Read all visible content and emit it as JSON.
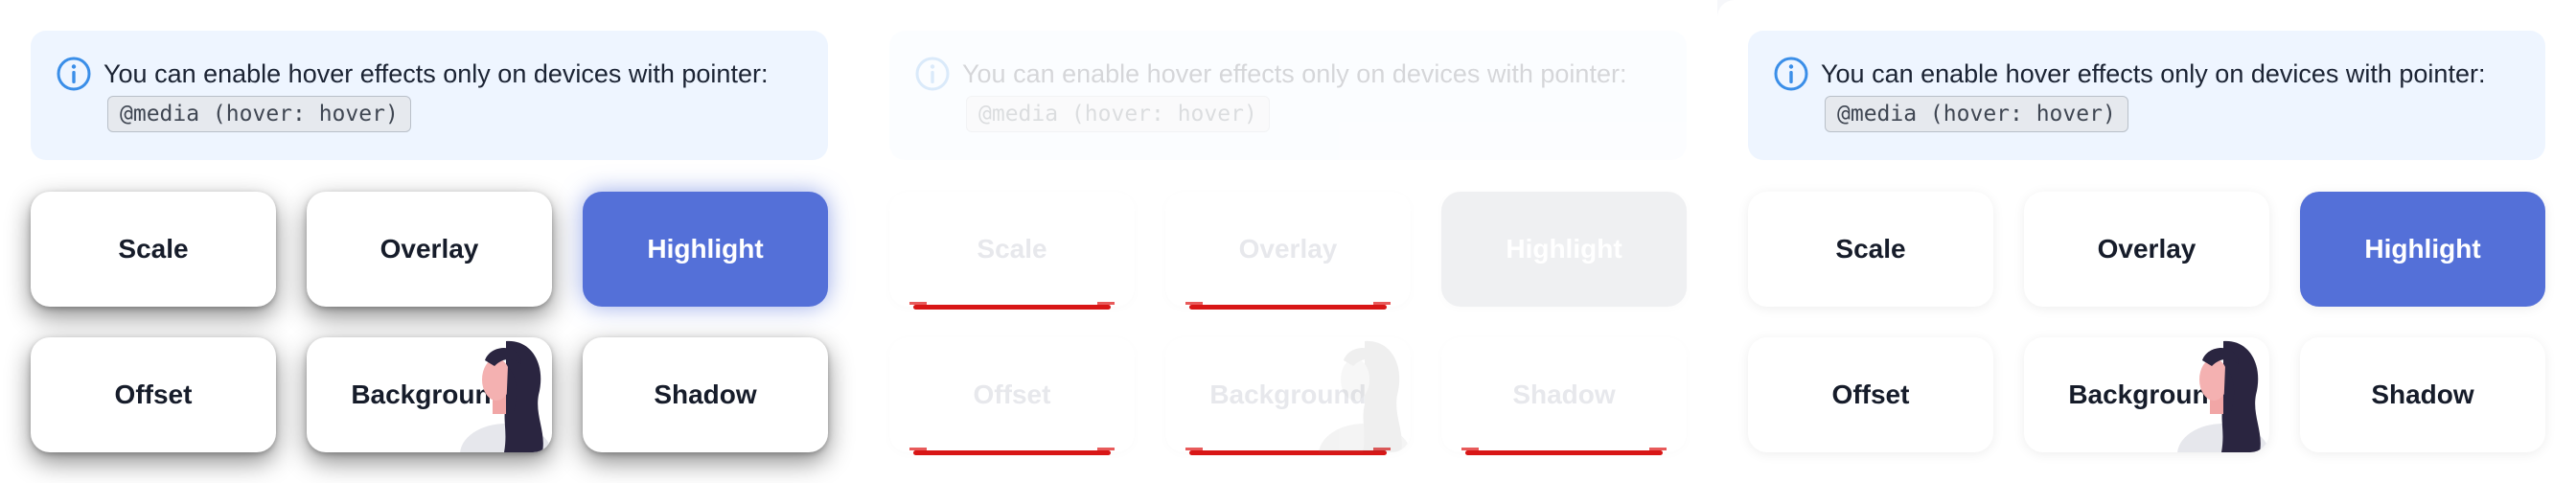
{
  "notice": {
    "text": "You can enable hover effects only on devices with pointer:",
    "code": "@media (hover: hover)",
    "icon": "info-icon"
  },
  "buttons": {
    "scale": "Scale",
    "overlay": "Overlay",
    "highlight": "Highlight",
    "offset": "Offset",
    "background": "Background",
    "shadow": "Shadow"
  },
  "colors": {
    "accent": "#5470d8",
    "info_bg": "#eef5ff",
    "info_icon": "#3a8ee8",
    "underline": "#d81616"
  }
}
